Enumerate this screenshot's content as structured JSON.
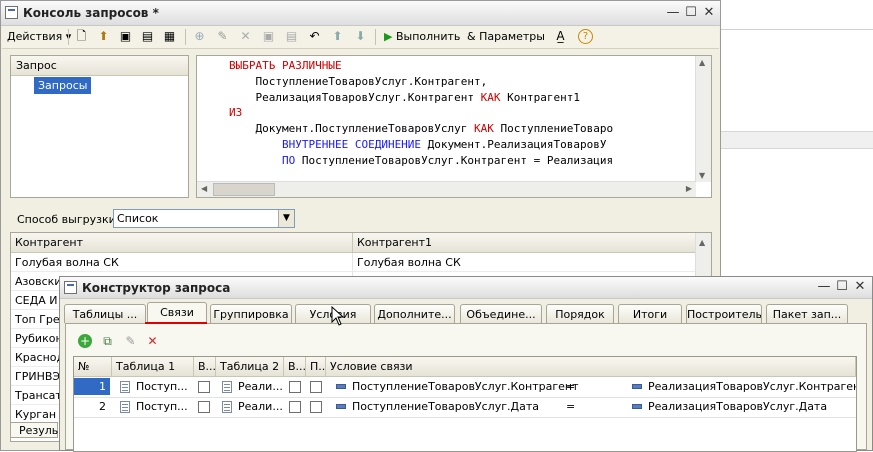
{
  "console": {
    "title": "Консоль запросов *",
    "toolbar": {
      "actions_label": "Действия",
      "run_label": "Выполнить",
      "params_label": "Параметры"
    },
    "tree": {
      "header": "Запрос",
      "item": "Запросы"
    },
    "query_lines": [
      {
        "parts": [
          {
            "t": "ВЫБРАТЬ РАЗЛИЧНЫЕ",
            "c": "kw"
          }
        ]
      },
      {
        "parts": [
          {
            "t": "    ПоступлениеТоваровУслуг.Контрагент,",
            "c": ""
          }
        ]
      },
      {
        "parts": [
          {
            "t": "    РеализацияТоваровУслуг.Контрагент ",
            "c": ""
          },
          {
            "t": "КАК",
            "c": "kw"
          },
          {
            "t": " Контрагент1",
            "c": ""
          }
        ]
      },
      {
        "parts": [
          {
            "t": "ИЗ",
            "c": "kw"
          }
        ]
      },
      {
        "parts": [
          {
            "t": "    Документ.ПоступлениеТоваровУслуг ",
            "c": ""
          },
          {
            "t": "КАК",
            "c": "kw"
          },
          {
            "t": " ПоступлениеТоваро",
            "c": ""
          }
        ]
      },
      {
        "parts": [
          {
            "t": "        ВНУТРЕННЕЕ СОЕДИНЕНИЕ",
            "c": "kwb"
          },
          {
            "t": " Документ.РеализацияТоваровУ",
            "c": ""
          }
        ]
      },
      {
        "parts": [
          {
            "t": "        ПО",
            "c": "kwb"
          },
          {
            "t": " ПоступлениеТоваровУслуг.Контрагент = Реализация",
            "c": ""
          }
        ]
      }
    ],
    "export_label": "Способ выгрузки:",
    "export_value": "Список",
    "result_columns": [
      "Контрагент",
      "Контрагент1"
    ],
    "result_rows": [
      [
        "Голубая волна СК",
        "Голубая волна СК"
      ],
      [
        "Азовски",
        ""
      ],
      [
        "СЕДА И",
        ""
      ],
      [
        "Топ Грег",
        ""
      ],
      [
        "Рубикон",
        ""
      ],
      [
        "Краснод",
        ""
      ],
      [
        "ГРИНВЭ",
        ""
      ],
      [
        "Трансат",
        ""
      ],
      [
        "Курган",
        ""
      ]
    ],
    "bottom_tab": "Резуль"
  },
  "constructor": {
    "title": "Конструктор запроса",
    "tabs": [
      "Таблицы ...",
      "Связи",
      "Группировка",
      "Условия",
      "Дополните...",
      "Объедине...",
      "Порядок",
      "Итоги",
      "Построитель",
      "Пакет зап..."
    ],
    "active_tab": 1,
    "columns": [
      "№",
      "Таблица 1",
      "В...",
      "Таблица 2",
      "В...",
      "П...",
      "Условие связи"
    ],
    "rows": [
      {
        "num": "1",
        "table1": "Поступ...",
        "table2": "Реали...",
        "field1": "ПоступлениеТоваровУслуг.Контрагент",
        "op": "=",
        "field2": "РеализацияТоваровУслуг.Контрагент"
      },
      {
        "num": "2",
        "table1": "Поступ...",
        "table2": "Реали...",
        "field1": "ПоступлениеТоваровУслуг.Дата",
        "op": "=",
        "field2": "РеализацияТоваровУслуг.Дата"
      }
    ]
  },
  "colors": {
    "selection": "#316ac5",
    "keyword": "#d00000",
    "keyword_join": "#1a1aff",
    "tab_underline": "#e00000"
  }
}
